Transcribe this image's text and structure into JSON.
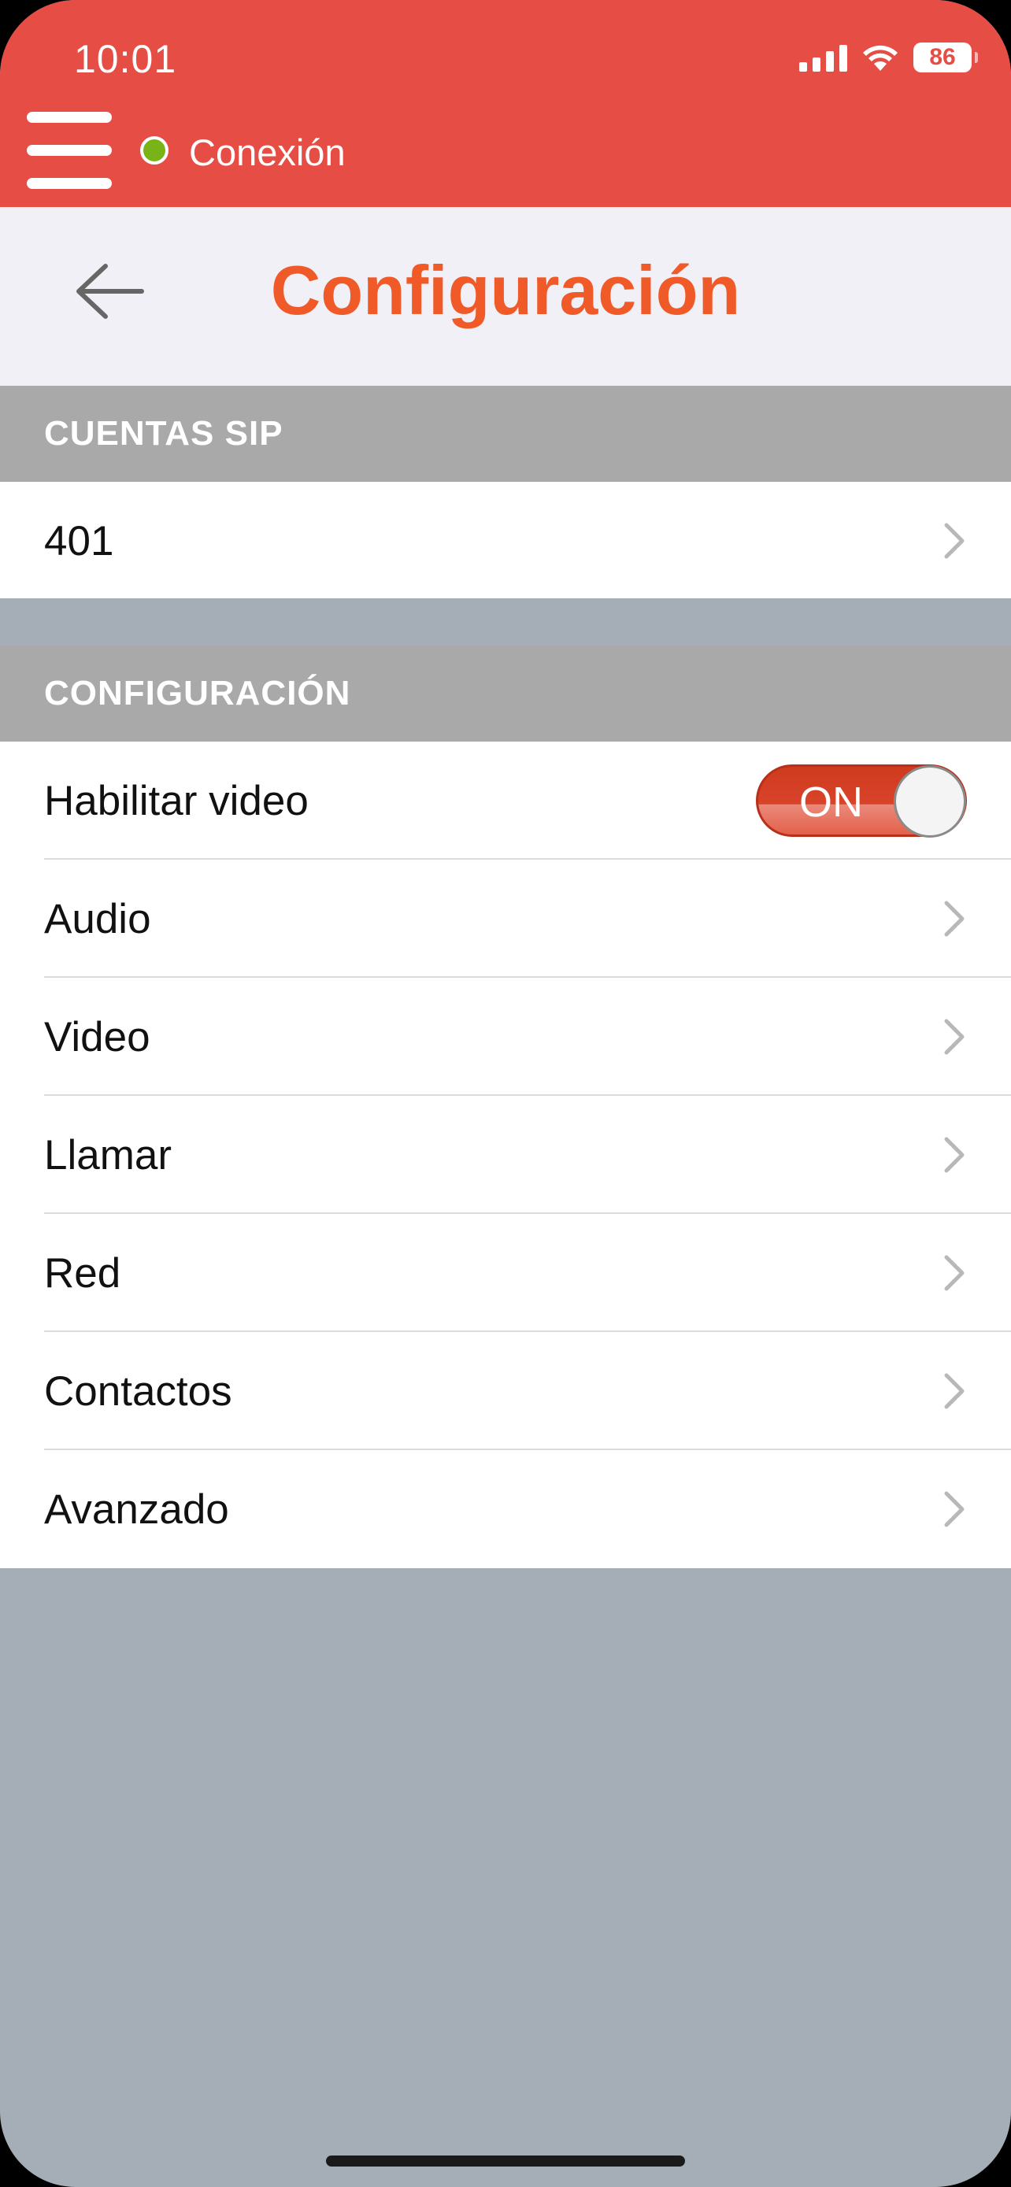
{
  "status_bar": {
    "time": "10:01",
    "battery": "86",
    "icons": [
      "signal-icon",
      "wifi-icon",
      "battery-icon"
    ]
  },
  "top_bar": {
    "connection_label": "Conexión",
    "connection_status_color": "#7ab317",
    "background_color": "#e54d45"
  },
  "header": {
    "title": "Configuración",
    "title_color": "#f05a28"
  },
  "sections": [
    {
      "header": "CUENTAS SIP",
      "rows": [
        {
          "label": "401",
          "type": "link"
        }
      ]
    },
    {
      "header": "CONFIGURACIÓN",
      "rows": [
        {
          "label": "Habilitar video",
          "type": "toggle",
          "toggle_text": "ON",
          "toggle_on": true
        },
        {
          "label": "Audio",
          "type": "link"
        },
        {
          "label": "Video",
          "type": "link"
        },
        {
          "label": "Llamar",
          "type": "link"
        },
        {
          "label": "Red",
          "type": "link"
        },
        {
          "label": "Contactos",
          "type": "link"
        },
        {
          "label": "Avanzado",
          "type": "link"
        }
      ]
    }
  ]
}
